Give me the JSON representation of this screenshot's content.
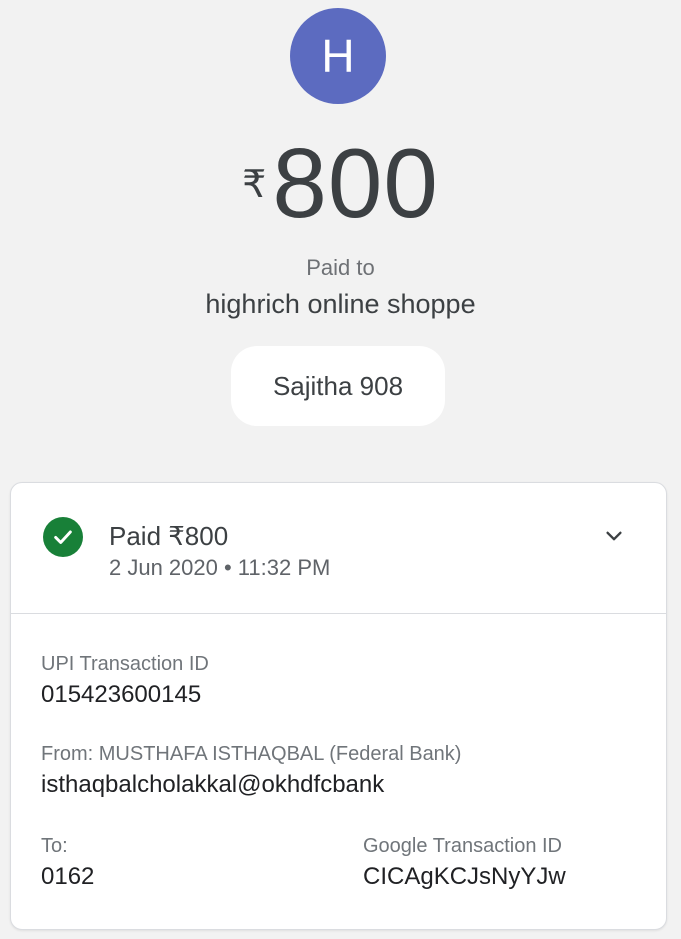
{
  "header": {
    "avatar_initial": "H",
    "avatar_color": "#5c6bc0",
    "currency_symbol": "₹",
    "amount": "800",
    "paid_to_label": "Paid to",
    "payee_name": "highrich online shoppe",
    "note": "Sajitha 908"
  },
  "transaction": {
    "status_icon": "check-circle-icon",
    "status_color": "#188038",
    "status_title": "Paid ₹800",
    "datetime": "2 Jun 2020 • 11:32 PM",
    "expand_icon": "chevron-down-icon",
    "upi_id_label": "UPI Transaction ID",
    "upi_id": "015423600145",
    "from_label": "From: MUSTHAFA ISTHAQBAL (Federal Bank)",
    "from_vpa": "isthaqbalcholakkal@okhdfcbank",
    "to_label": "To:",
    "to_value": "0162",
    "google_id_label": "Google Transaction ID",
    "google_id": "CICAgKCJsNyYJw"
  }
}
